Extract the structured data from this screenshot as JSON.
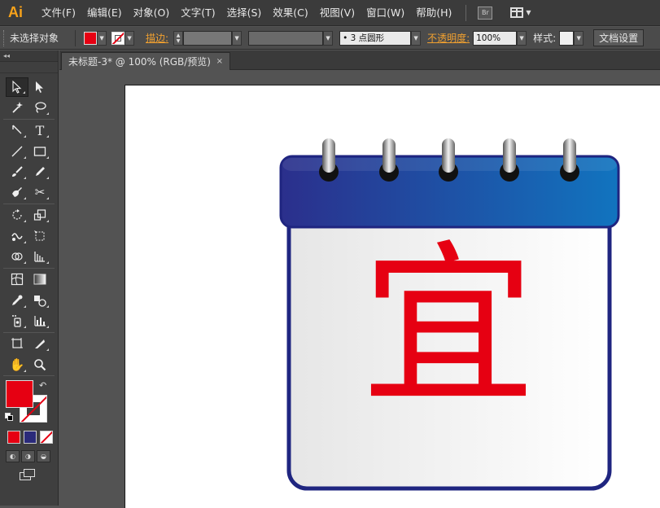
{
  "app": {
    "logo": "Ai",
    "logo_color": "#f7a21a"
  },
  "menu": [
    "文件(F)",
    "编辑(E)",
    "对象(O)",
    "文字(T)",
    "选择(S)",
    "效果(C)",
    "视图(V)",
    "窗口(W)",
    "帮助(H)"
  ],
  "menubar_extra": {
    "bridge": "Br",
    "workspace_icon": "workspace-grid-icon"
  },
  "control_bar": {
    "selection_status": "未选择对象",
    "fill_color": "#e60012",
    "stroke_label": "描边:",
    "stroke_value": "",
    "brush_value": "",
    "profile_value": "•  3 点圆形",
    "opacity_label": "不透明度:",
    "opacity_value": "100%",
    "style_label": "样式:",
    "doc_setup": "文档设置"
  },
  "document": {
    "tab_title": "未标题-3* @ 100% (RGB/预览)",
    "close": "×"
  },
  "toolbar": {
    "tools": [
      [
        "selection-tool",
        "direct-selection-tool"
      ],
      [
        "magic-wand-tool",
        "lasso-tool"
      ],
      [
        "pen-tool",
        "type-tool"
      ],
      [
        "line-segment-tool",
        "rectangle-tool"
      ],
      [
        "paintbrush-tool",
        "pencil-tool"
      ],
      [
        "blob-brush-tool",
        "scissors-tool"
      ],
      [
        "rotate-tool",
        "scale-tool"
      ],
      [
        "warp-tool",
        "free-transform-tool"
      ],
      [
        "shape-builder-tool",
        "perspective-grid-tool"
      ],
      [
        "mesh-tool",
        "gradient-tool"
      ],
      [
        "eyedropper-tool",
        "blend-tool"
      ],
      [
        "symbol-sprayer-tool",
        "column-graph-tool"
      ],
      [
        "artboard-tool",
        "slice-tool"
      ],
      [
        "hand-tool",
        "zoom-tool"
      ]
    ],
    "fill_color": "#e60012",
    "stroke_color": "#e60012",
    "mode_colors": [
      "#e60012",
      "#2a2a7a",
      "none"
    ]
  },
  "artwork": {
    "character": "宜",
    "character_color": "#e60012",
    "header_gradient": [
      "#2b2f8c",
      "#1174bf"
    ],
    "body_gradient": [
      "#e6e6e6",
      "#ffffff"
    ],
    "border_color": "#1f2580",
    "rings": 5
  }
}
